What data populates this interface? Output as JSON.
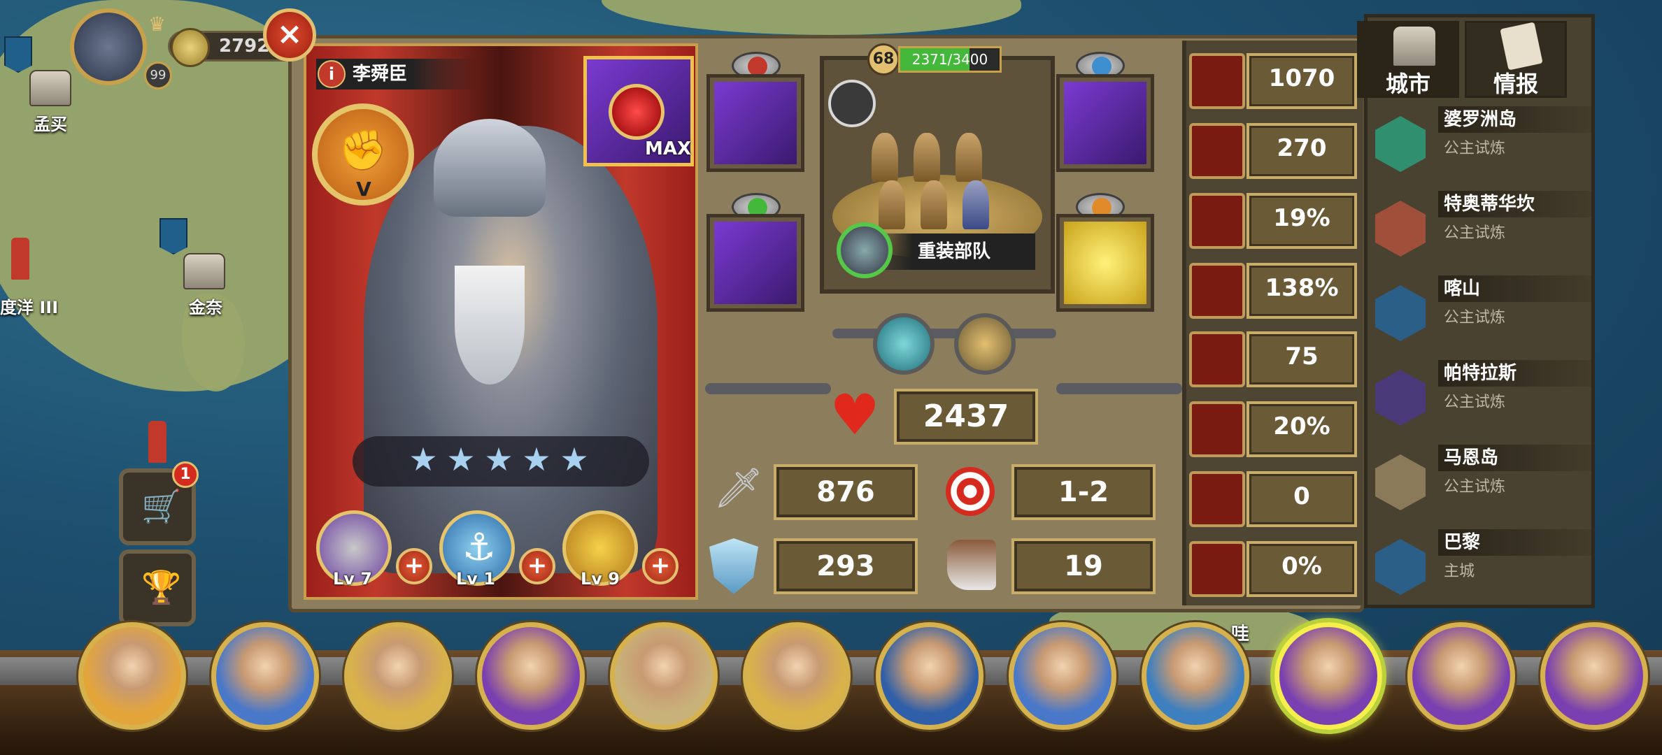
{
  "top_left": {
    "gold_amount": "2792",
    "player_level": "99"
  },
  "map_labels": [
    "孟买",
    "度洋 III",
    "金奈",
    "哇"
  ],
  "hero": {
    "name": "李舜臣",
    "rank": "V",
    "stars": 5,
    "artifact_label": "MAX",
    "skills": [
      {
        "name": "armor-skill",
        "level": "Lv 7"
      },
      {
        "name": "anchor-skill",
        "level": "Lv 1"
      },
      {
        "name": "horn-skill",
        "level": "Lv 9"
      }
    ]
  },
  "troop": {
    "level": "68",
    "exp_text": "2371/3400",
    "exp_fraction": 0.697,
    "name": "重装部队"
  },
  "stats": {
    "hp": "2437",
    "attack": "876",
    "range": "1-2",
    "defense": "293",
    "move": "19"
  },
  "right_stats": [
    {
      "icon": "target-icon",
      "value": "1070"
    },
    {
      "icon": "speed-icon",
      "value": "270"
    },
    {
      "icon": "crit-icon",
      "value": "19%"
    },
    {
      "icon": "crit-damage-icon",
      "value": "138%"
    },
    {
      "icon": "heal-icon",
      "value": "75"
    },
    {
      "icon": "rank-up-icon",
      "value": "20%"
    },
    {
      "icon": "fist-icon",
      "value": "0"
    },
    {
      "icon": "dodge-icon",
      "value": "0%"
    }
  ],
  "city_panel": {
    "tabs": [
      "城市",
      "情报"
    ],
    "cities": [
      {
        "name": "婆罗洲岛",
        "type": "公主试炼",
        "color": "#2f8f6f"
      },
      {
        "name": "特奥蒂华坎",
        "type": "公主试炼",
        "color": "#a0503a"
      },
      {
        "name": "喀山",
        "type": "公主试炼",
        "color": "#2c5f88"
      },
      {
        "name": "帕特拉斯",
        "type": "公主试炼",
        "color": "#4a3a7a"
      },
      {
        "name": "马恩岛",
        "type": "公主试炼",
        "color": "#8a7a5a"
      },
      {
        "name": "巴黎",
        "type": "主城",
        "color": "#2c5f88"
      }
    ]
  },
  "side_buttons": {
    "shop_badge": "1"
  },
  "bottom_heroes": [
    {
      "color": "#e3a53a"
    },
    {
      "color": "#4a78c9"
    },
    {
      "color": "#d9b24a"
    },
    {
      "color": "#7a3fb0"
    },
    {
      "color": "#c9b27a"
    },
    {
      "color": "#d9b24a"
    },
    {
      "color": "#2e5fa8"
    },
    {
      "color": "#4a78c9"
    },
    {
      "color": "#3e7fc0"
    },
    {
      "color": "#7a3fb0",
      "selected": true
    },
    {
      "color": "#7a3fb0"
    },
    {
      "color": "#7a3fb0"
    }
  ]
}
